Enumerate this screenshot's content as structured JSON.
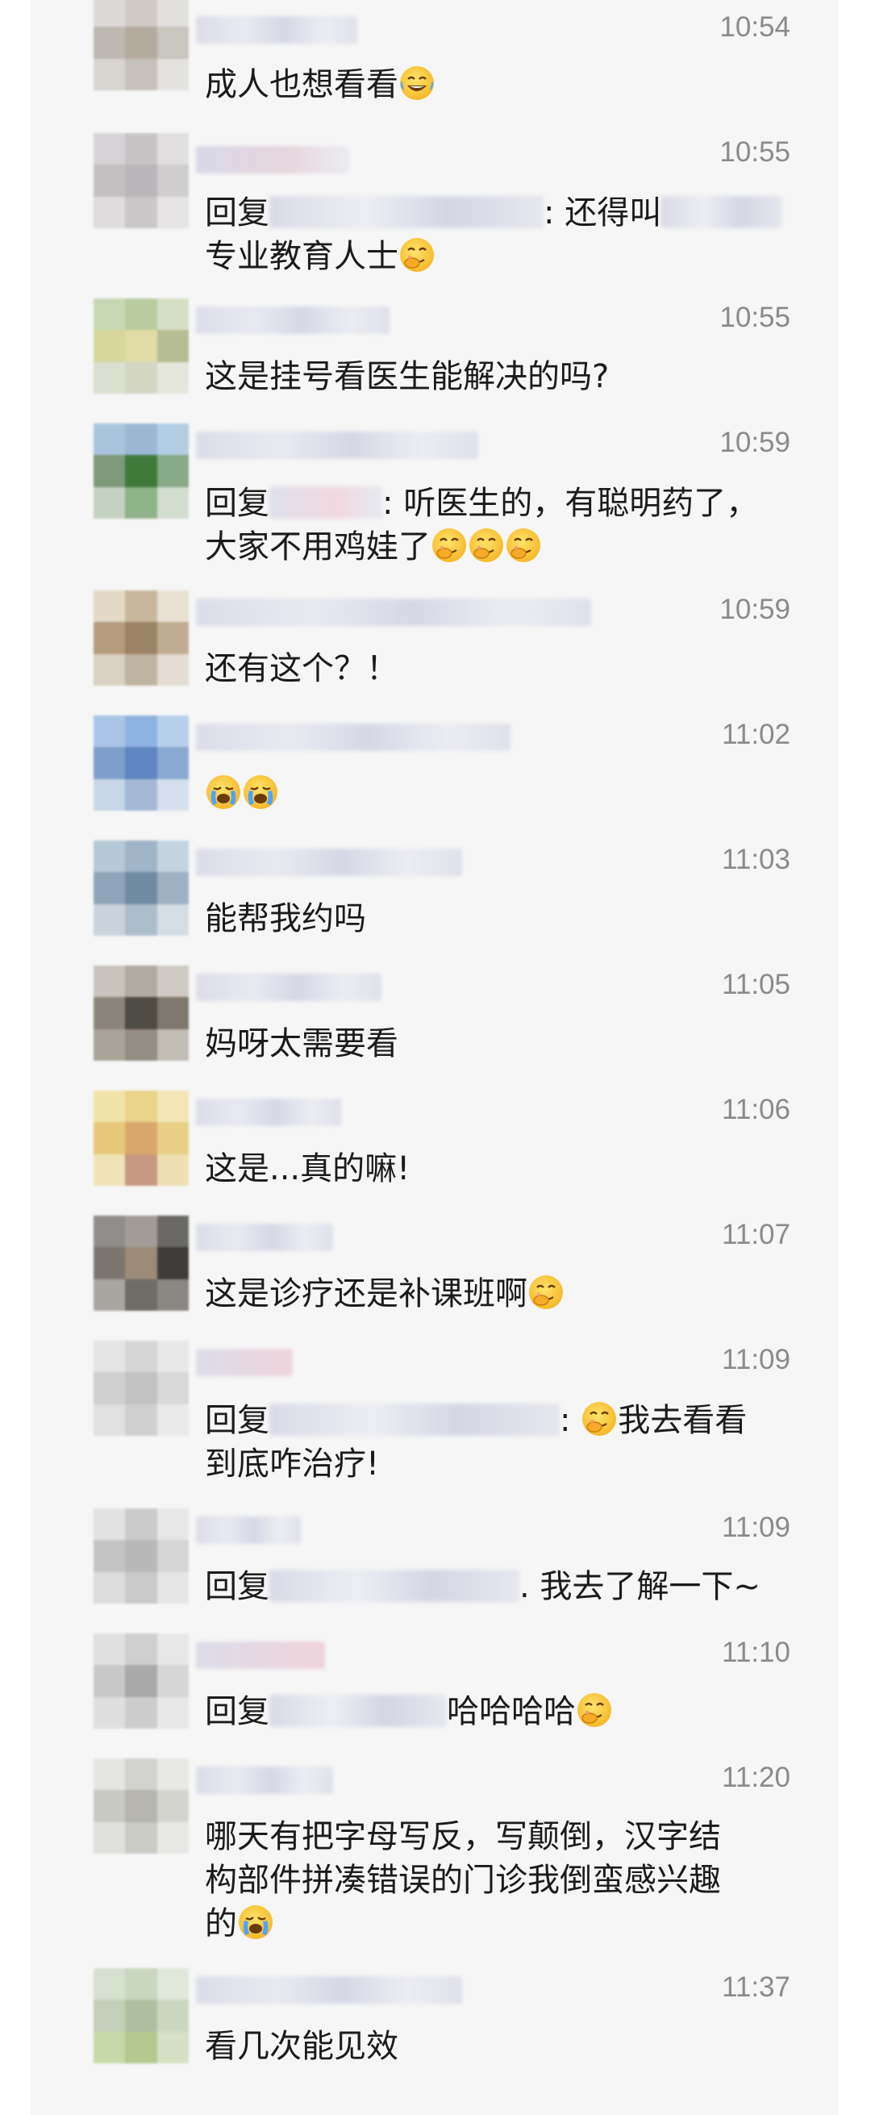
{
  "comments": [
    {
      "time": "10:54",
      "line1": "成人也想看看",
      "line2": ""
    },
    {
      "time": "10:55",
      "reply_prefix": "回复",
      "line1_rest": ": 还得叫",
      "line2": "专业教育人士"
    },
    {
      "time": "10:55",
      "line1": "这是挂号看医生能解决的吗?",
      "line2": ""
    },
    {
      "time": "10:59",
      "reply_prefix": "回复",
      "line1_rest": ": 听医生的，有聪明药了，",
      "line2": "大家不用鸡娃了"
    },
    {
      "time": "10:59",
      "line1": "还有这个？！",
      "line2": ""
    },
    {
      "time": "11:02",
      "line1": "",
      "line2": ""
    },
    {
      "time": "11:03",
      "line1": "能帮我约吗",
      "line2": ""
    },
    {
      "time": "11:05",
      "line1": "妈呀太需要看",
      "line2": ""
    },
    {
      "time": "11:06",
      "line1": "这是...真的嘛!",
      "line2": ""
    },
    {
      "time": "11:07",
      "line1": "这是诊疗还是补课班啊",
      "line2": ""
    },
    {
      "time": "11:09",
      "reply_prefix": "回复",
      "line1_rest": ":",
      "line1_after": "我去看看",
      "line2": "到底咋治疗!"
    },
    {
      "time": "11:09",
      "reply_prefix": "回复",
      "line1_rest": ". 我去了解一下~",
      "line2": ""
    },
    {
      "time": "11:10",
      "reply_prefix": "回复",
      "line1_rest": "哈哈哈哈",
      "line2": ""
    },
    {
      "time": "11:20",
      "line1": "哪天有把字母写反，写颠倒，汉字结",
      "line2": "构部件拼凑错误的门诊我倒蛮感兴趣",
      "line3": "的"
    },
    {
      "time": "11:37",
      "line1": "看几次能见效",
      "line2": ""
    }
  ],
  "icons": {
    "laugh": "face-with-tears-of-joy-icon",
    "think": "face-with-hand-over-mouth-icon",
    "cry": "loudly-crying-face-icon"
  },
  "colors": {
    "panel": "#f6f6f6",
    "text": "#1b1b1b",
    "time": "#8a8a8a"
  }
}
